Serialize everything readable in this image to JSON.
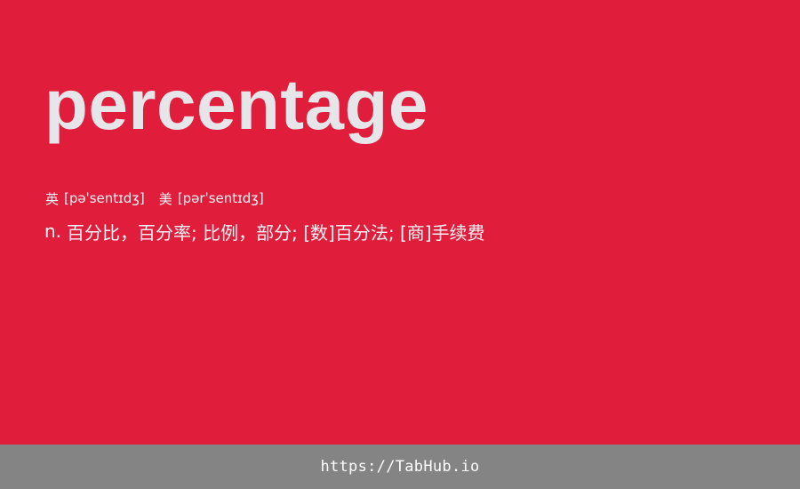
{
  "entry": {
    "word": "percentage",
    "pronunciations": [
      {
        "region": "英",
        "ipa": "[pəˈsentɪdʒ]"
      },
      {
        "region": "美",
        "ipa": "[pərˈsentɪdʒ]"
      }
    ],
    "definition": {
      "part_of_speech": "n.",
      "meaning": "百分比，百分率; 比例，部分; [数]百分法; [商]手续费"
    }
  },
  "footer": {
    "link_text": "https://TabHub.io"
  },
  "colors": {
    "background": "#e01e3c",
    "word_text": "#e6e6ea",
    "footer_bg": "#848484",
    "footer_text": "#ffffff"
  }
}
